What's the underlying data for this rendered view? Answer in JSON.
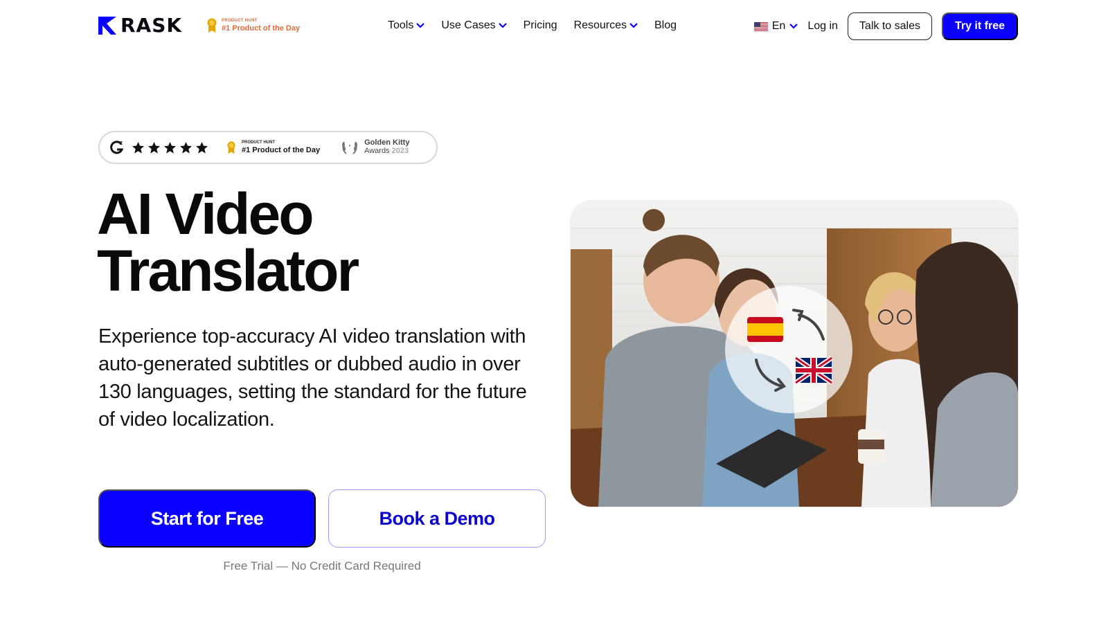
{
  "header": {
    "brand": "Rask",
    "logo_text": "RASK",
    "product_hunt_small": "PRODUCT HUNT",
    "product_hunt_badge": "#1 Product of the Day",
    "nav": [
      {
        "label": "Tools",
        "has_dropdown": true
      },
      {
        "label": "Use Cases",
        "has_dropdown": true
      },
      {
        "label": "Pricing",
        "has_dropdown": false
      },
      {
        "label": "Resources",
        "has_dropdown": true
      },
      {
        "label": "Blog",
        "has_dropdown": false
      }
    ],
    "language": "En",
    "login": "Log in",
    "talk_to_sales": "Talk to sales",
    "try_free": "Try it free"
  },
  "awards": {
    "g2_icon": "g2-logo-icon",
    "rating_stars": 4.5,
    "ph_small": "PRODUCT HUNT",
    "ph_label": "#1 Product of the Day",
    "gk_line1": "Golden Kitty",
    "gk_line2": "Awards",
    "gk_year": "2023"
  },
  "hero": {
    "title_line1": "AI Video",
    "title_line2": "Translator",
    "description": "Experience top-accuracy AI video translation with auto-generated subtitles or dubbed audio in over 130 languages, setting the standard for the future of video localization.",
    "cta_primary": "Start for Free",
    "cta_secondary": "Book a Demo",
    "note": "Free Trial — No Credit Card Required"
  },
  "colors": {
    "brand_blue": "#0b00ff",
    "medal_gold": "#e0a800",
    "ph_orange": "#e06a3a"
  }
}
